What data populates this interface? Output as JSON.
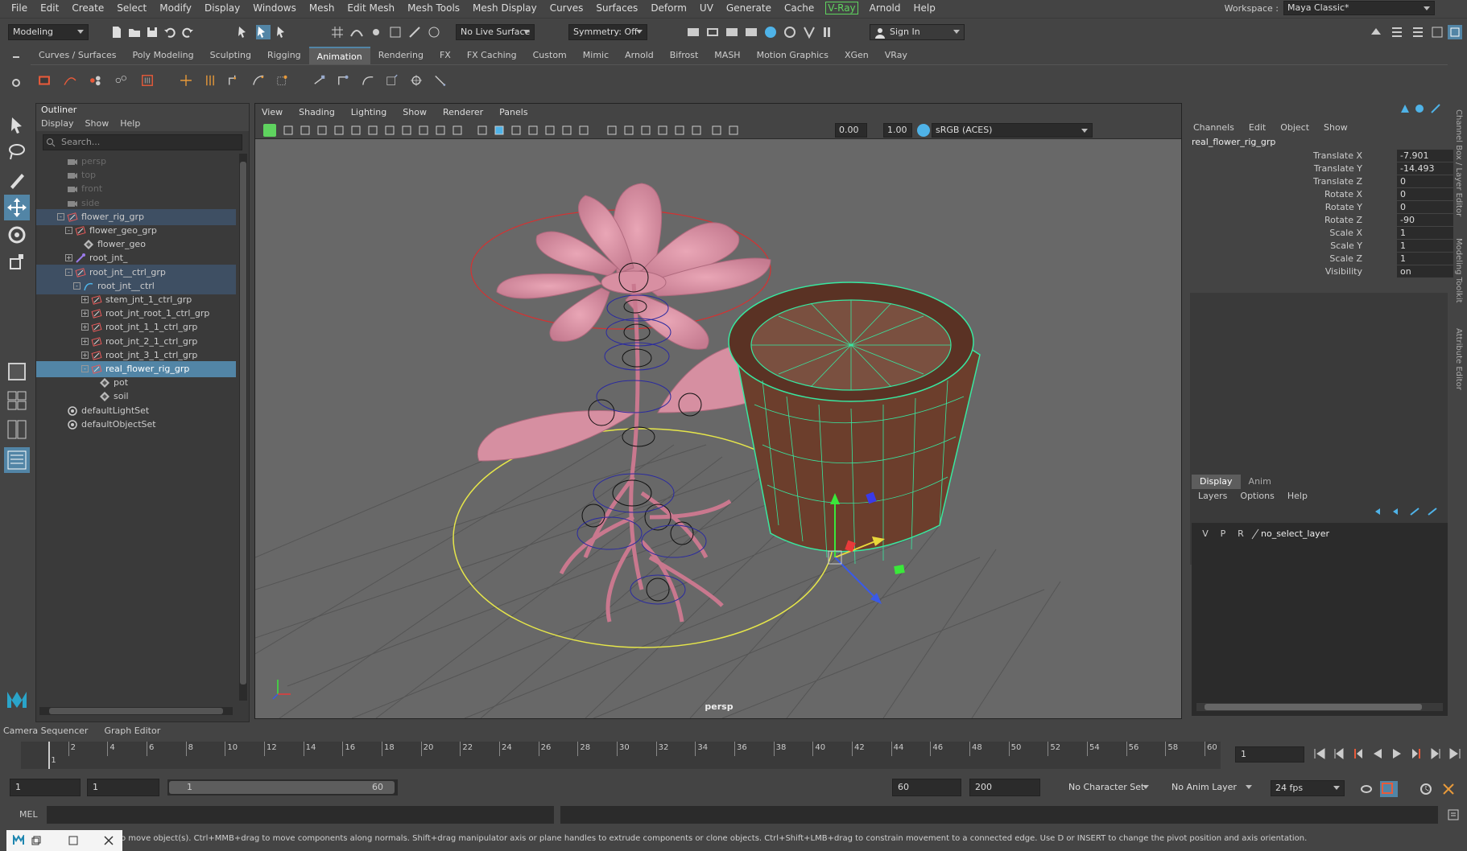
{
  "menu": [
    "File",
    "Edit",
    "Create",
    "Select",
    "Modify",
    "Display",
    "Windows",
    "Mesh",
    "Edit Mesh",
    "Mesh Tools",
    "Mesh Display",
    "Curves",
    "Surfaces",
    "Deform",
    "UV",
    "Generate",
    "Cache",
    "V-Ray",
    "Arnold",
    "Help"
  ],
  "workspace": {
    "label": "Workspace :",
    "value": "Maya Classic*"
  },
  "status": {
    "mode": "Modeling",
    "live_surface": "No Live Surface",
    "symmetry": "Symmetry: Off",
    "sign_in": "Sign In"
  },
  "shelf_tabs": [
    "Curves / Surfaces",
    "Poly Modeling",
    "Sculpting",
    "Rigging",
    "Animation",
    "Rendering",
    "FX",
    "FX Caching",
    "Custom",
    "Mimic",
    "Arnold",
    "Bifrost",
    "MASH",
    "Motion Graphics",
    "XGen",
    "VRay"
  ],
  "shelf_active": "Animation",
  "outliner": {
    "title": "Outliner",
    "menu": [
      "Display",
      "Show",
      "Help"
    ],
    "search_placeholder": "Search...",
    "items": [
      {
        "label": "persp",
        "level": 1,
        "state": "dim",
        "icon": "camera-icon"
      },
      {
        "label": "top",
        "level": 1,
        "state": "dim",
        "icon": "camera-icon"
      },
      {
        "label": "front",
        "level": 1,
        "state": "dim",
        "icon": "camera-icon"
      },
      {
        "label": "side",
        "level": 1,
        "state": "dim",
        "icon": "camera-icon"
      },
      {
        "label": "flower_rig_grp",
        "level": 1,
        "state": "sel-light",
        "icon": "group-icon",
        "exp": "-"
      },
      {
        "label": "flower_geo_grp",
        "level": 2,
        "state": "",
        "icon": "group-icon",
        "exp": "-"
      },
      {
        "label": "flower_geo",
        "level": 3,
        "state": "",
        "icon": "mesh-icon"
      },
      {
        "label": "root_jnt_",
        "level": 2,
        "state": "",
        "icon": "joint-icon",
        "exp": "+"
      },
      {
        "label": "root_jnt__ctrl_grp",
        "level": 2,
        "state": "sel-light",
        "icon": "group-icon",
        "exp": "-"
      },
      {
        "label": "root_jnt__ctrl",
        "level": 3,
        "state": "sel-light",
        "icon": "curve-icon",
        "exp": "-"
      },
      {
        "label": "stem_jnt_1_ctrl_grp",
        "level": 4,
        "state": "",
        "icon": "group-icon",
        "exp": "+"
      },
      {
        "label": "root_jnt_root_1_ctrl_grp",
        "level": 4,
        "state": "",
        "icon": "group-icon",
        "exp": "+"
      },
      {
        "label": "root_jnt_1_1_ctrl_grp",
        "level": 4,
        "state": "",
        "icon": "group-icon",
        "exp": "+"
      },
      {
        "label": "root_jnt_2_1_ctrl_grp",
        "level": 4,
        "state": "",
        "icon": "group-icon",
        "exp": "+"
      },
      {
        "label": "root_jnt_3_1_ctrl_grp",
        "level": 4,
        "state": "",
        "icon": "group-icon",
        "exp": "+"
      },
      {
        "label": "real_flower_rig_grp",
        "level": 4,
        "state": "sel-strong",
        "icon": "group-icon",
        "exp": "-"
      },
      {
        "label": "pot",
        "level": 5,
        "state": "",
        "icon": "mesh-icon"
      },
      {
        "label": "soil",
        "level": 5,
        "state": "",
        "icon": "mesh-icon"
      },
      {
        "label": "defaultLightSet",
        "level": 1,
        "state": "",
        "icon": "set-icon"
      },
      {
        "label": "defaultObjectSet",
        "level": 1,
        "state": "",
        "icon": "set-icon"
      }
    ]
  },
  "viewport": {
    "menu": [
      "View",
      "Shading",
      "Lighting",
      "Show",
      "Renderer",
      "Panels"
    ],
    "near": "0.00",
    "far": "1.00",
    "color_space": "sRGB (ACES)",
    "camera_label": "persp"
  },
  "channel_box": {
    "menu": [
      "Channels",
      "Edit",
      "Object",
      "Show"
    ],
    "object": "real_flower_rig_grp",
    "channels": [
      {
        "label": "Translate X",
        "value": "-7.901"
      },
      {
        "label": "Translate Y",
        "value": "-14.493"
      },
      {
        "label": "Translate Z",
        "value": "0"
      },
      {
        "label": "Rotate X",
        "value": "0"
      },
      {
        "label": "Rotate Y",
        "value": "0"
      },
      {
        "label": "Rotate Z",
        "value": "-90"
      },
      {
        "label": "Scale X",
        "value": "1"
      },
      {
        "label": "Scale Y",
        "value": "1"
      },
      {
        "label": "Scale Z",
        "value": "1"
      },
      {
        "label": "Visibility",
        "value": "on"
      }
    ],
    "side_tabs": [
      "Channel Box / Layer Editor",
      "Modeling Toolkit",
      "Attribute Editor"
    ]
  },
  "layers": {
    "tabs": [
      "Display",
      "Anim"
    ],
    "menu": [
      "Layers",
      "Options",
      "Help"
    ],
    "row": {
      "v": "V",
      "p": "P",
      "r": "R",
      "name": "no_select_layer"
    }
  },
  "panels_tabs": [
    "Camera Sequencer",
    "Graph Editor"
  ],
  "timeline": {
    "ticks": [
      "1",
      "2",
      "4",
      "6",
      "8",
      "10",
      "12",
      "14",
      "16",
      "18",
      "20",
      "22",
      "24",
      "26",
      "28",
      "30",
      "32",
      "34",
      "36",
      "38",
      "40",
      "42",
      "44",
      "46",
      "48",
      "50",
      "52",
      "54",
      "56",
      "58",
      "60"
    ],
    "current_frame": "1"
  },
  "range": {
    "start": "1",
    "anim_start": "1",
    "slider_start": "1",
    "slider_end": "60",
    "end": "60",
    "anim_end": "200",
    "character_set": "No Character Set",
    "anim_layer": "No Anim Layer",
    "fps": "24 fps"
  },
  "command": {
    "label": "MEL"
  },
  "help_line": "o move object(s). Ctrl+MMB+drag to move components along normals. Shift+drag manipulator axis or plane handles to extrude components or clone objects. Ctrl+Shift+LMB+drag to constrain movement to a connected edge. Use D or INSERT to change the pivot position and axis orientation.",
  "colors": {
    "selection": "#5285a6",
    "petal": "#d98fa3",
    "pot": "#7a4a35",
    "wire": "#38e8a0",
    "bg": "#444444",
    "viewport": "#686868"
  }
}
